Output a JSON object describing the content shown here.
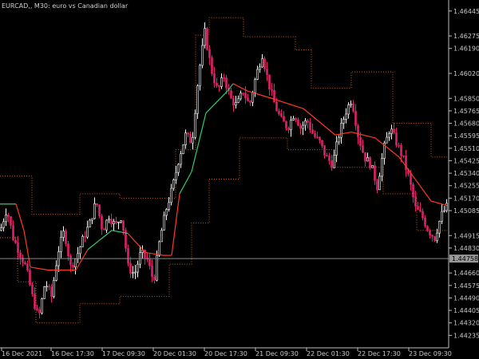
{
  "window": {
    "title": "EURCAD,, M30:  euro vs Canadian dollar"
  },
  "colors": {
    "background": "#000000",
    "axis": "#c0c0c0",
    "bull_candle": "#ffffff",
    "bear_candle": "#e0206a",
    "upper_band": "#d06020",
    "lower_band": "#d06020",
    "trend_down": "#ff3b1f",
    "trend_up": "#2ecc71",
    "current_price_line": "#8a8a8a"
  },
  "chart_data": {
    "type": "candlestick",
    "symbol": "EURCAD",
    "timeframe": "M30",
    "description": "euro vs Canadian dollar",
    "current_price": "1.44758",
    "ylim": [
      1.4415,
      1.4652
    ],
    "y_ticks": [
      "1.46445",
      "1.46275",
      "1.46190",
      "1.46020",
      "1.45850",
      "1.45765",
      "1.45680",
      "1.45595",
      "1.45510",
      "1.45425",
      "1.45340",
      "1.45255",
      "1.45170",
      "1.45085",
      "1.44915",
      "1.44830",
      "1.44660",
      "1.44575",
      "1.44490",
      "1.44405",
      "1.44320",
      "1.44235"
    ],
    "x_ticks": [
      "16 Dec 2021",
      "16 Dec 17:30",
      "17 Dec 09:30",
      "20 Dec 01:30",
      "20 Dec 17:30",
      "21 Dec 09:30",
      "22 Dec 01:30",
      "22 Dec 17:30",
      "23 Dec 09:30"
    ],
    "close_path": [
      [
        0,
        1.4495
      ],
      [
        8,
        1.451
      ],
      [
        16,
        1.449
      ],
      [
        24,
        1.448
      ],
      [
        32,
        1.447
      ],
      [
        40,
        1.445
      ],
      [
        48,
        1.4435
      ],
      [
        56,
        1.446
      ],
      [
        64,
        1.445
      ],
      [
        72,
        1.448
      ],
      [
        80,
        1.4495
      ],
      [
        88,
        1.447
      ],
      [
        96,
        1.4478
      ],
      [
        104,
        1.449
      ],
      [
        112,
        1.45
      ],
      [
        120,
        1.4515
      ],
      [
        128,
        1.4495
      ],
      [
        136,
        1.4505
      ],
      [
        144,
        1.4498
      ],
      [
        152,
        1.4505
      ],
      [
        160,
        1.447
      ],
      [
        168,
        1.4465
      ],
      [
        176,
        1.448
      ],
      [
        184,
        1.4475
      ],
      [
        192,
        1.446
      ],
      [
        200,
        1.449
      ],
      [
        208,
        1.451
      ],
      [
        216,
        1.4525
      ],
      [
        224,
        1.4545
      ],
      [
        232,
        1.456
      ],
      [
        240,
        1.4555
      ],
      [
        248,
        1.46
      ],
      [
        256,
        1.463
      ],
      [
        264,
        1.4605
      ],
      [
        272,
        1.459
      ],
      [
        280,
        1.46
      ],
      [
        288,
        1.4585
      ],
      [
        296,
        1.458
      ],
      [
        304,
        1.459
      ],
      [
        312,
        1.458
      ],
      [
        320,
        1.46
      ],
      [
        328,
        1.4615
      ],
      [
        336,
        1.4595
      ],
      [
        344,
        1.458
      ],
      [
        352,
        1.457
      ],
      [
        360,
        1.4565
      ],
      [
        368,
        1.4575
      ],
      [
        376,
        1.4565
      ],
      [
        384,
        1.457
      ],
      [
        392,
        1.456
      ],
      [
        400,
        1.4555
      ],
      [
        408,
        1.4545
      ],
      [
        416,
        1.454
      ],
      [
        424,
        1.456
      ],
      [
        432,
        1.4575
      ],
      [
        440,
        1.4585
      ],
      [
        448,
        1.456
      ],
      [
        456,
        1.4545
      ],
      [
        464,
        1.454
      ],
      [
        472,
        1.4525
      ],
      [
        480,
        1.455
      ],
      [
        488,
        1.4565
      ],
      [
        496,
        1.4555
      ],
      [
        504,
        1.4545
      ],
      [
        512,
        1.453
      ],
      [
        520,
        1.451
      ],
      [
        528,
        1.4505
      ],
      [
        536,
        1.4495
      ],
      [
        544,
        1.449
      ],
      [
        552,
        1.4505
      ],
      [
        560,
        1.4512
      ]
    ],
    "indicators": {
      "upper_band": [
        [
          0,
          1.4532
        ],
        [
          40,
          1.4532
        ],
        [
          40,
          1.4506
        ],
        [
          100,
          1.4506
        ],
        [
          100,
          1.452
        ],
        [
          150,
          1.452
        ],
        [
          150,
          1.4517
        ],
        [
          220,
          1.4517
        ],
        [
          220,
          1.455
        ],
        [
          245,
          1.455
        ],
        [
          245,
          1.4628
        ],
        [
          262,
          1.4628
        ],
        [
          262,
          1.464
        ],
        [
          305,
          1.464
        ],
        [
          305,
          1.4627
        ],
        [
          370,
          1.4627
        ],
        [
          370,
          1.4618
        ],
        [
          390,
          1.4618
        ],
        [
          390,
          1.4592
        ],
        [
          440,
          1.4592
        ],
        [
          440,
          1.4603
        ],
        [
          492,
          1.4603
        ],
        [
          492,
          1.4568
        ],
        [
          540,
          1.4568
        ],
        [
          540,
          1.4545
        ],
        [
          560,
          1.4545
        ]
      ],
      "lower_band": [
        [
          0,
          1.449
        ],
        [
          22,
          1.449
        ],
        [
          22,
          1.446
        ],
        [
          45,
          1.446
        ],
        [
          45,
          1.4432
        ],
        [
          100,
          1.4432
        ],
        [
          100,
          1.4445
        ],
        [
          150,
          1.4445
        ],
        [
          150,
          1.445
        ],
        [
          212,
          1.445
        ],
        [
          212,
          1.4472
        ],
        [
          240,
          1.4472
        ],
        [
          240,
          1.45
        ],
        [
          262,
          1.45
        ],
        [
          262,
          1.453
        ],
        [
          300,
          1.453
        ],
        [
          300,
          1.4558
        ],
        [
          360,
          1.4558
        ],
        [
          360,
          1.455
        ],
        [
          420,
          1.455
        ],
        [
          420,
          1.4538
        ],
        [
          480,
          1.4538
        ],
        [
          480,
          1.452
        ],
        [
          522,
          1.452
        ],
        [
          522,
          1.4495
        ],
        [
          560,
          1.4495
        ]
      ],
      "trend_line": [
        [
          0,
          1.4513
        ],
        [
          20,
          1.4513
        ],
        [
          30,
          1.4495
        ],
        [
          38,
          1.447
        ],
        [
          60,
          1.4468
        ],
        [
          95,
          1.4468
        ],
        [
          110,
          1.4482
        ],
        [
          140,
          1.4495
        ],
        [
          160,
          1.4493
        ],
        [
          182,
          1.448
        ],
        [
          205,
          1.4478
        ],
        [
          215,
          1.4478
        ],
        [
          225,
          1.452
        ],
        [
          240,
          1.4535
        ],
        [
          258,
          1.4575
        ],
        [
          285,
          1.459
        ],
        [
          292,
          1.4595
        ],
        [
          310,
          1.459
        ],
        [
          340,
          1.4585
        ],
        [
          380,
          1.4578
        ],
        [
          420,
          1.456
        ],
        [
          440,
          1.4562
        ],
        [
          470,
          1.4558
        ],
        [
          500,
          1.4545
        ],
        [
          520,
          1.453
        ],
        [
          540,
          1.4515
        ],
        [
          560,
          1.4512
        ]
      ],
      "trend_up_x_ranges": [
        [
          0,
          20
        ],
        [
          110,
          160
        ],
        [
          225,
          300
        ]
      ]
    }
  }
}
